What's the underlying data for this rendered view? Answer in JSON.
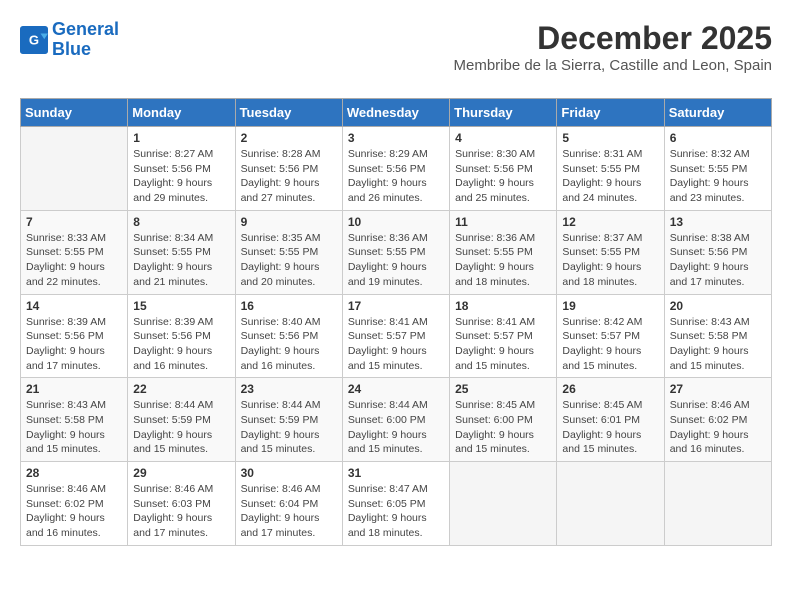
{
  "logo": {
    "line1": "General",
    "line2": "Blue"
  },
  "title": "December 2025",
  "subtitle": "Membribe de la Sierra, Castille and Leon, Spain",
  "days_of_week": [
    "Sunday",
    "Monday",
    "Tuesday",
    "Wednesday",
    "Thursday",
    "Friday",
    "Saturday"
  ],
  "weeks": [
    [
      {
        "day": "",
        "info": ""
      },
      {
        "day": "1",
        "info": "Sunrise: 8:27 AM\nSunset: 5:56 PM\nDaylight: 9 hours\nand 29 minutes."
      },
      {
        "day": "2",
        "info": "Sunrise: 8:28 AM\nSunset: 5:56 PM\nDaylight: 9 hours\nand 27 minutes."
      },
      {
        "day": "3",
        "info": "Sunrise: 8:29 AM\nSunset: 5:56 PM\nDaylight: 9 hours\nand 26 minutes."
      },
      {
        "day": "4",
        "info": "Sunrise: 8:30 AM\nSunset: 5:56 PM\nDaylight: 9 hours\nand 25 minutes."
      },
      {
        "day": "5",
        "info": "Sunrise: 8:31 AM\nSunset: 5:55 PM\nDaylight: 9 hours\nand 24 minutes."
      },
      {
        "day": "6",
        "info": "Sunrise: 8:32 AM\nSunset: 5:55 PM\nDaylight: 9 hours\nand 23 minutes."
      }
    ],
    [
      {
        "day": "7",
        "info": "Sunrise: 8:33 AM\nSunset: 5:55 PM\nDaylight: 9 hours\nand 22 minutes."
      },
      {
        "day": "8",
        "info": "Sunrise: 8:34 AM\nSunset: 5:55 PM\nDaylight: 9 hours\nand 21 minutes."
      },
      {
        "day": "9",
        "info": "Sunrise: 8:35 AM\nSunset: 5:55 PM\nDaylight: 9 hours\nand 20 minutes."
      },
      {
        "day": "10",
        "info": "Sunrise: 8:36 AM\nSunset: 5:55 PM\nDaylight: 9 hours\nand 19 minutes."
      },
      {
        "day": "11",
        "info": "Sunrise: 8:36 AM\nSunset: 5:55 PM\nDaylight: 9 hours\nand 18 minutes."
      },
      {
        "day": "12",
        "info": "Sunrise: 8:37 AM\nSunset: 5:55 PM\nDaylight: 9 hours\nand 18 minutes."
      },
      {
        "day": "13",
        "info": "Sunrise: 8:38 AM\nSunset: 5:56 PM\nDaylight: 9 hours\nand 17 minutes."
      }
    ],
    [
      {
        "day": "14",
        "info": "Sunrise: 8:39 AM\nSunset: 5:56 PM\nDaylight: 9 hours\nand 17 minutes."
      },
      {
        "day": "15",
        "info": "Sunrise: 8:39 AM\nSunset: 5:56 PM\nDaylight: 9 hours\nand 16 minutes."
      },
      {
        "day": "16",
        "info": "Sunrise: 8:40 AM\nSunset: 5:56 PM\nDaylight: 9 hours\nand 16 minutes."
      },
      {
        "day": "17",
        "info": "Sunrise: 8:41 AM\nSunset: 5:57 PM\nDaylight: 9 hours\nand 15 minutes."
      },
      {
        "day": "18",
        "info": "Sunrise: 8:41 AM\nSunset: 5:57 PM\nDaylight: 9 hours\nand 15 minutes."
      },
      {
        "day": "19",
        "info": "Sunrise: 8:42 AM\nSunset: 5:57 PM\nDaylight: 9 hours\nand 15 minutes."
      },
      {
        "day": "20",
        "info": "Sunrise: 8:43 AM\nSunset: 5:58 PM\nDaylight: 9 hours\nand 15 minutes."
      }
    ],
    [
      {
        "day": "21",
        "info": "Sunrise: 8:43 AM\nSunset: 5:58 PM\nDaylight: 9 hours\nand 15 minutes."
      },
      {
        "day": "22",
        "info": "Sunrise: 8:44 AM\nSunset: 5:59 PM\nDaylight: 9 hours\nand 15 minutes."
      },
      {
        "day": "23",
        "info": "Sunrise: 8:44 AM\nSunset: 5:59 PM\nDaylight: 9 hours\nand 15 minutes."
      },
      {
        "day": "24",
        "info": "Sunrise: 8:44 AM\nSunset: 6:00 PM\nDaylight: 9 hours\nand 15 minutes."
      },
      {
        "day": "25",
        "info": "Sunrise: 8:45 AM\nSunset: 6:00 PM\nDaylight: 9 hours\nand 15 minutes."
      },
      {
        "day": "26",
        "info": "Sunrise: 8:45 AM\nSunset: 6:01 PM\nDaylight: 9 hours\nand 15 minutes."
      },
      {
        "day": "27",
        "info": "Sunrise: 8:46 AM\nSunset: 6:02 PM\nDaylight: 9 hours\nand 16 minutes."
      }
    ],
    [
      {
        "day": "28",
        "info": "Sunrise: 8:46 AM\nSunset: 6:02 PM\nDaylight: 9 hours\nand 16 minutes."
      },
      {
        "day": "29",
        "info": "Sunrise: 8:46 AM\nSunset: 6:03 PM\nDaylight: 9 hours\nand 17 minutes."
      },
      {
        "day": "30",
        "info": "Sunrise: 8:46 AM\nSunset: 6:04 PM\nDaylight: 9 hours\nand 17 minutes."
      },
      {
        "day": "31",
        "info": "Sunrise: 8:47 AM\nSunset: 6:05 PM\nDaylight: 9 hours\nand 18 minutes."
      },
      {
        "day": "",
        "info": ""
      },
      {
        "day": "",
        "info": ""
      },
      {
        "day": "",
        "info": ""
      }
    ]
  ]
}
